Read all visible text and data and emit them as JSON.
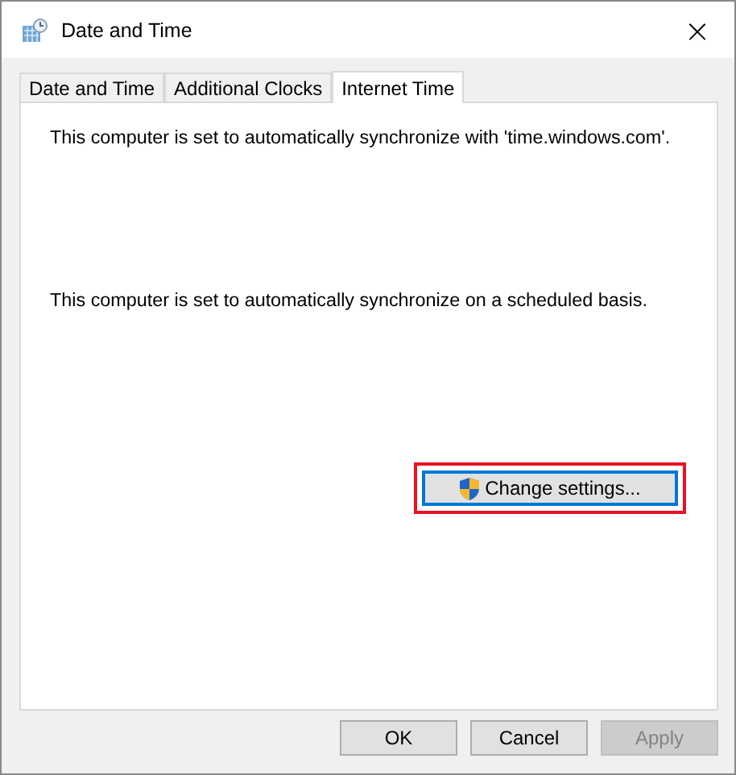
{
  "window": {
    "title": "Date and Time",
    "close": "×"
  },
  "tabs": [
    {
      "label": "Date and Time",
      "selected": false
    },
    {
      "label": "Additional Clocks",
      "selected": false
    },
    {
      "label": "Internet Time",
      "selected": true
    }
  ],
  "messages": [
    "This computer is set to automatically synchronize with 'time.windows.com'.",
    "This computer is set to automatically synchronize on a scheduled basis."
  ],
  "change_settings": {
    "label": "Change settings...",
    "highlighted": true
  },
  "buttons": [
    {
      "label": "OK",
      "disabled": false
    },
    {
      "label": "Cancel",
      "disabled": false
    },
    {
      "label": "Apply",
      "disabled": true
    }
  ]
}
